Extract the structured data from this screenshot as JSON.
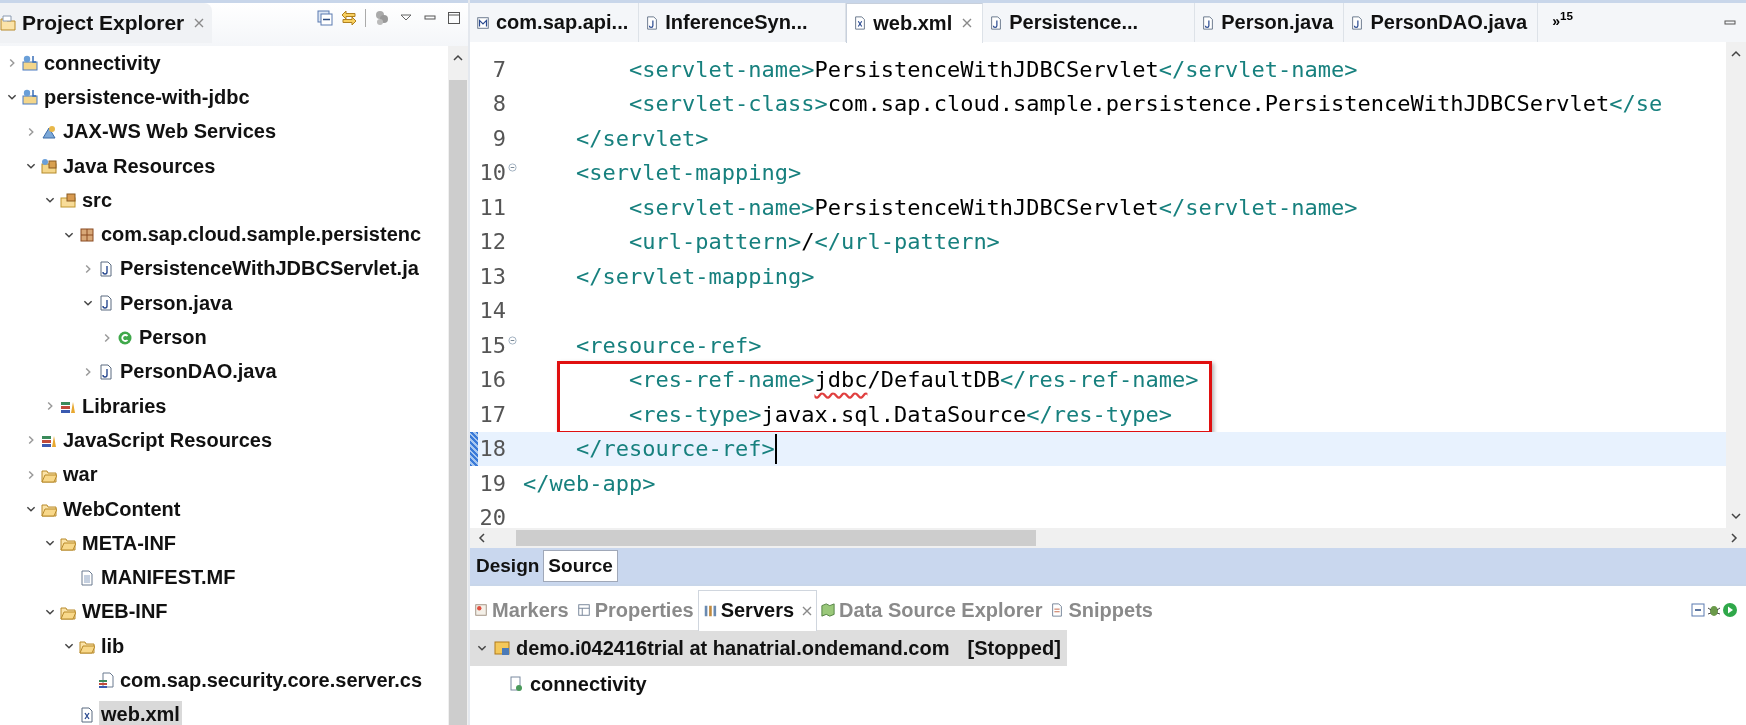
{
  "explorer": {
    "title": "Project Explorer",
    "tree": [
      {
        "label": "connectivity",
        "kind": "project",
        "expanded": false,
        "selected": false
      },
      {
        "label": "persistence-with-jdbc",
        "kind": "project",
        "expanded": true,
        "selected": false,
        "children": [
          {
            "label": "JAX-WS Web Services",
            "kind": "webservice",
            "expanded": false,
            "selected": false
          },
          {
            "label": "Java Resources",
            "kind": "javares",
            "expanded": true,
            "selected": false,
            "children": [
              {
                "label": "src",
                "kind": "srcfolder",
                "expanded": true,
                "selected": false,
                "children": [
                  {
                    "label": "com.sap.cloud.sample.persistenc",
                    "kind": "package",
                    "expanded": true,
                    "selected": false,
                    "children": [
                      {
                        "label": "PersistenceWithJDBCServlet.ja",
                        "kind": "javafile",
                        "expanded": false,
                        "selected": false
                      },
                      {
                        "label": "Person.java",
                        "kind": "javafile",
                        "expanded": true,
                        "selected": false,
                        "children": [
                          {
                            "label": "Person",
                            "kind": "class",
                            "expanded": false,
                            "selected": false
                          }
                        ]
                      },
                      {
                        "label": "PersonDAO.java",
                        "kind": "javafile",
                        "expanded": false,
                        "selected": false
                      }
                    ]
                  }
                ]
              },
              {
                "label": "Libraries",
                "kind": "library",
                "expanded": false,
                "selected": false
              }
            ]
          },
          {
            "label": "JavaScript Resources",
            "kind": "library",
            "expanded": false,
            "selected": false
          },
          {
            "label": "war",
            "kind": "folder",
            "expanded": false,
            "selected": false
          },
          {
            "label": "WebContent",
            "kind": "folder",
            "expanded": true,
            "selected": false,
            "children": [
              {
                "label": "META-INF",
                "kind": "folder",
                "expanded": true,
                "selected": false,
                "children": [
                  {
                    "label": "MANIFEST.MF",
                    "kind": "textfile",
                    "selected": false
                  }
                ]
              },
              {
                "label": "WEB-INF",
                "kind": "folder",
                "expanded": true,
                "selected": false,
                "children": [
                  {
                    "label": "lib",
                    "kind": "folder",
                    "expanded": true,
                    "selected": false,
                    "children": [
                      {
                        "label": "com.sap.security.core.server.cs",
                        "kind": "jar",
                        "selected": false
                      }
                    ]
                  },
                  {
                    "label": "web.xml",
                    "kind": "xmlfile",
                    "selected": true
                  }
                ]
              }
            ]
          }
        ]
      }
    ]
  },
  "editor": {
    "tabs": [
      {
        "label": "com.sap.api...",
        "kind": "manifest",
        "selected": false
      },
      {
        "label": "InferenceSyn...",
        "kind": "javafile",
        "selected": false
      },
      {
        "label": "web.xml",
        "kind": "xmlfile",
        "selected": true
      },
      {
        "label": "Persistence...",
        "kind": "javafile",
        "selected": false
      },
      {
        "label": "Person.java",
        "kind": "javafile",
        "selected": false
      },
      {
        "label": "PersonDAO.java",
        "kind": "javafile",
        "selected": false
      }
    ],
    "overflow": "»$^{15}$",
    "lines": [
      {
        "number": "7",
        "kind": "inner",
        "foldable": false,
        "current": false,
        "boxed": false,
        "segments": [
          {
            "kind": "tag",
            "text": "<servlet-name>"
          },
          {
            "kind": "plain",
            "text": "PersistenceWithJDBCServlet"
          },
          {
            "kind": "tag",
            "text": "</servlet-name>"
          }
        ]
      },
      {
        "number": "8",
        "kind": "inner",
        "foldable": false,
        "current": false,
        "boxed": false,
        "segments": [
          {
            "kind": "tag",
            "text": "<servlet-class>"
          },
          {
            "kind": "plain",
            "text": "com.sap.cloud.sample.persistence.PersistenceWithJDBCServlet"
          },
          {
            "kind": "tag",
            "text": "</se"
          }
        ]
      },
      {
        "number": "9",
        "kind": "outer",
        "foldable": false,
        "current": false,
        "boxed": false,
        "segments": [
          {
            "kind": "tag",
            "text": "</servlet>"
          }
        ]
      },
      {
        "number": "10",
        "kind": "outer",
        "foldable": true,
        "current": false,
        "boxed": false,
        "segments": [
          {
            "kind": "tag",
            "text": "<servlet-mapping>"
          }
        ]
      },
      {
        "number": "11",
        "kind": "inner",
        "foldable": false,
        "current": false,
        "boxed": false,
        "segments": [
          {
            "kind": "tag",
            "text": "<servlet-name>"
          },
          {
            "kind": "plain",
            "text": "PersistenceWithJDBCServlet"
          },
          {
            "kind": "tag",
            "text": "</servlet-name>"
          }
        ]
      },
      {
        "number": "12",
        "kind": "inner",
        "foldable": false,
        "current": false,
        "boxed": false,
        "segments": [
          {
            "kind": "tag",
            "text": "<url-pattern>"
          },
          {
            "kind": "plain",
            "text": "/"
          },
          {
            "kind": "tag",
            "text": "</url-pattern>"
          }
        ]
      },
      {
        "number": "13",
        "kind": "outer",
        "foldable": false,
        "current": false,
        "boxed": false,
        "segments": [
          {
            "kind": "tag",
            "text": "</servlet-mapping>"
          }
        ]
      },
      {
        "number": "14",
        "foldable": false,
        "current": false,
        "boxed": false
      },
      {
        "number": "15",
        "kind": "outer",
        "foldable": true,
        "current": false,
        "boxed": false,
        "segments": [
          {
            "kind": "tag",
            "text": "<resource-ref>"
          }
        ]
      },
      {
        "number": "16",
        "kind": "inner",
        "foldable": false,
        "current": false,
        "boxed": true,
        "segments": [
          {
            "kind": "tag",
            "text": "<res-ref-name>"
          },
          {
            "kind": "misspelled",
            "text": "jdbc"
          },
          {
            "kind": "plain",
            "text": "/DefaultDB"
          },
          {
            "kind": "tag",
            "text": "</res-ref-name>"
          }
        ]
      },
      {
        "number": "17",
        "kind": "inner",
        "foldable": false,
        "current": false,
        "boxed": true,
        "segments": [
          {
            "kind": "tag",
            "text": "<res-type>"
          },
          {
            "kind": "plain",
            "text": "javax.sql.DataSource"
          },
          {
            "kind": "tag",
            "text": "</res-type>"
          }
        ]
      },
      {
        "number": "18",
        "kind": "outer",
        "foldable": false,
        "current": true,
        "boxed": false,
        "segments": [
          {
            "kind": "tag",
            "text": "</resource-ref>"
          }
        ]
      },
      {
        "number": "19",
        "kind": "root",
        "foldable": false,
        "current": false,
        "boxed": false,
        "segments": [
          {
            "kind": "tag",
            "text": "</web-app>"
          }
        ]
      },
      {
        "number": "20",
        "foldable": false,
        "current": false,
        "boxed": false
      }
    ],
    "mode_tabs": [
      {
        "label": "Design",
        "selected": false
      },
      {
        "label": "Source",
        "selected": true
      }
    ]
  },
  "bottom_panel": {
    "tabs": [
      {
        "label": "Markers",
        "kind": "markers",
        "selected": false
      },
      {
        "label": "Properties",
        "kind": "properties",
        "selected": false
      },
      {
        "label": "Servers",
        "kind": "servers",
        "selected": true
      },
      {
        "label": "Data Source Explorer",
        "kind": "datasource",
        "selected": false
      },
      {
        "label": "Snippets",
        "kind": "snippets",
        "selected": false
      }
    ],
    "servers": [
      {
        "name": "demo.i042416trial at hanatrial.ondemand.com",
        "status": "[Stopped]",
        "expanded": true,
        "selected": true,
        "children": [
          {
            "name": "connectivity"
          }
        ]
      }
    ]
  }
}
